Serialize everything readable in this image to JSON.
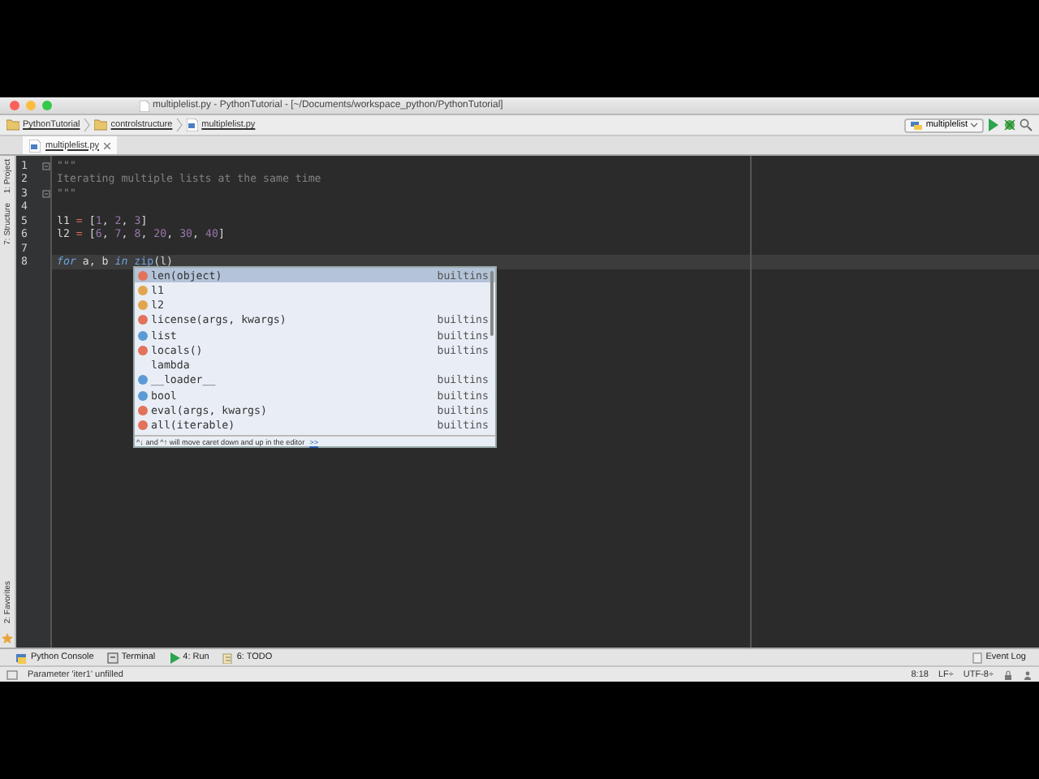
{
  "window": {
    "title": "multiplelist.py - PythonTutorial - [~/Documents/workspace_python/PythonTutorial]"
  },
  "breadcrumb": [
    "PythonTutorial",
    "controlstructure",
    "multiplelist.py"
  ],
  "run_config": "multiplelist",
  "tabs": [
    {
      "label": "multiplelist.py",
      "selected": true
    }
  ],
  "left_tools": [
    "1: Project",
    "7: Structure"
  ],
  "left_tools_bottom": [
    "2: Favorites"
  ],
  "code_lines": [
    {
      "number": "1",
      "fold": true,
      "current": false,
      "tokens": [
        {
          "text": "\"\"\"",
          "kind": "doc"
        }
      ]
    },
    {
      "number": "2",
      "fold": false,
      "current": false,
      "tokens": [
        {
          "text": "Iterating multiple lists at the same time",
          "kind": "doc"
        }
      ]
    },
    {
      "number": "3",
      "fold": true,
      "current": false,
      "tokens": [
        {
          "text": "\"\"\"",
          "kind": "doc"
        }
      ]
    },
    {
      "number": "4",
      "fold": false,
      "current": false
    },
    {
      "number": "5",
      "fold": false,
      "current": false,
      "tokens": [
        {
          "text": "l1 ",
          "kind": "id"
        },
        {
          "text": "=",
          "kind": "op"
        },
        {
          "text": " [",
          "kind": "id"
        },
        {
          "text": "1",
          "kind": "num"
        },
        {
          "text": ", ",
          "kind": "id"
        },
        {
          "text": "2",
          "kind": "num"
        },
        {
          "text": ", ",
          "kind": "id"
        },
        {
          "text": "3",
          "kind": "num"
        },
        {
          "text": "]",
          "kind": "id"
        }
      ]
    },
    {
      "number": "6",
      "fold": false,
      "current": false,
      "tokens": [
        {
          "text": "l2 ",
          "kind": "id"
        },
        {
          "text": "=",
          "kind": "op"
        },
        {
          "text": " [",
          "kind": "id"
        },
        {
          "text": "6",
          "kind": "num"
        },
        {
          "text": ", ",
          "kind": "id"
        },
        {
          "text": "7",
          "kind": "num"
        },
        {
          "text": ", ",
          "kind": "id"
        },
        {
          "text": "8",
          "kind": "num"
        },
        {
          "text": ", ",
          "kind": "id"
        },
        {
          "text": "20",
          "kind": "num"
        },
        {
          "text": ", ",
          "kind": "id"
        },
        {
          "text": "30",
          "kind": "num"
        },
        {
          "text": ", ",
          "kind": "id"
        },
        {
          "text": "40",
          "kind": "num"
        },
        {
          "text": "]",
          "kind": "id"
        }
      ]
    },
    {
      "number": "7",
      "fold": false,
      "current": false
    },
    {
      "number": "8",
      "fold": false,
      "current": true,
      "tokens": [
        {
          "text": "for",
          "kind": "kw"
        },
        {
          "text": " a, b ",
          "kind": "id"
        },
        {
          "text": "in ",
          "kind": "kw"
        },
        {
          "text": "zip",
          "kind": "builtin"
        },
        {
          "text": "(l",
          "kind": "id"
        },
        {
          "text": ")",
          "kind": "id"
        }
      ]
    }
  ],
  "completion": {
    "items": [
      {
        "kind": "function",
        "label": "len(object)",
        "source": "builtins",
        "selected": true
      },
      {
        "kind": "variable",
        "label": "l1",
        "selected": false
      },
      {
        "kind": "variable",
        "label": "l2",
        "selected": false
      },
      {
        "kind": "function",
        "label": "license(args, kwargs)",
        "source": "builtins",
        "selected": false
      },
      {
        "kind": "class",
        "label": "list",
        "source": "builtins",
        "selected": false
      },
      {
        "kind": "function",
        "label": "locals()",
        "source": "builtins",
        "selected": false
      },
      {
        "kind": "keyword",
        "label": "lambda",
        "selected": false
      },
      {
        "kind": "class",
        "label": "__loader__",
        "source": "builtins",
        "selected": false
      },
      {
        "kind": "class",
        "label": "bool",
        "source": "builtins",
        "selected": false
      },
      {
        "kind": "function",
        "label": "eval(args, kwargs)",
        "source": "builtins",
        "selected": false
      },
      {
        "kind": "function",
        "label": "all(iterable)",
        "source": "builtins",
        "selected": false
      }
    ],
    "hint": "^↓ and ^↑ will move caret down and up in the editor",
    "hint_link": ">>"
  },
  "tool_windows": [
    "Python Console",
    "Terminal",
    "4: Run",
    "6: TODO"
  ],
  "event_log": "Event Log",
  "status_bar": {
    "message": "Parameter 'iter1' unfilled",
    "position": "8:18",
    "line_separator": "LF÷",
    "encoding": "UTF-8÷"
  }
}
